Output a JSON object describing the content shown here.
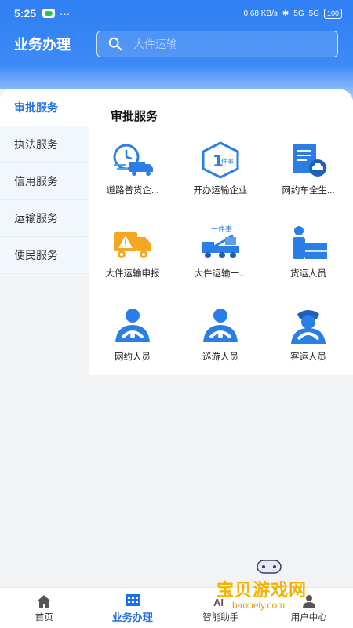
{
  "status_bar": {
    "time": "5:25",
    "extra": "···",
    "net_speed": "0.68 KB/s",
    "signal1": "5G",
    "signal2": "5G",
    "battery": "100"
  },
  "header": {
    "title": "业务办理",
    "search_placeholder": "大件运输"
  },
  "sidebar": {
    "items": [
      {
        "label": "审批服务"
      },
      {
        "label": "执法服务"
      },
      {
        "label": "信用服务"
      },
      {
        "label": "运输服务"
      },
      {
        "label": "便民服务"
      }
    ]
  },
  "content": {
    "title": "审批服务",
    "services": [
      {
        "label": "道路普货企...",
        "icon": "clock-truck-icon"
      },
      {
        "label": "开办运输企业",
        "icon": "hexagon-one-item-icon",
        "badge": "1",
        "badge_text": "件事"
      },
      {
        "label": "网约车全生...",
        "icon": "document-car-icon"
      },
      {
        "label": "大件运输申报",
        "icon": "warning-truck-icon"
      },
      {
        "label": "大件运输一...",
        "icon": "tow-truck-icon",
        "badge_text": "一件事"
      },
      {
        "label": "货运人员",
        "icon": "cargo-person-icon"
      },
      {
        "label": "网约人员",
        "icon": "driver-person-icon"
      },
      {
        "label": "巡游人员",
        "icon": "driver-person-icon"
      },
      {
        "label": "客运人员",
        "icon": "captain-person-icon"
      }
    ]
  },
  "bottom_nav": {
    "items": [
      {
        "label": "首页",
        "icon": "home-icon"
      },
      {
        "label": "业务办理",
        "icon": "business-building-icon"
      },
      {
        "label": "智能助手",
        "icon": "ai-assistant-icon"
      },
      {
        "label": "用户中心",
        "icon": "user-center-icon"
      }
    ]
  },
  "watermark": {
    "text": "宝贝游戏网",
    "url": "baobeiy.com"
  },
  "colors": {
    "primary": "#1d6ff0",
    "header_gradient_top": "#2f7ff3",
    "icon_blue": "#2a7ee6",
    "icon_orange": "#f5a623"
  }
}
